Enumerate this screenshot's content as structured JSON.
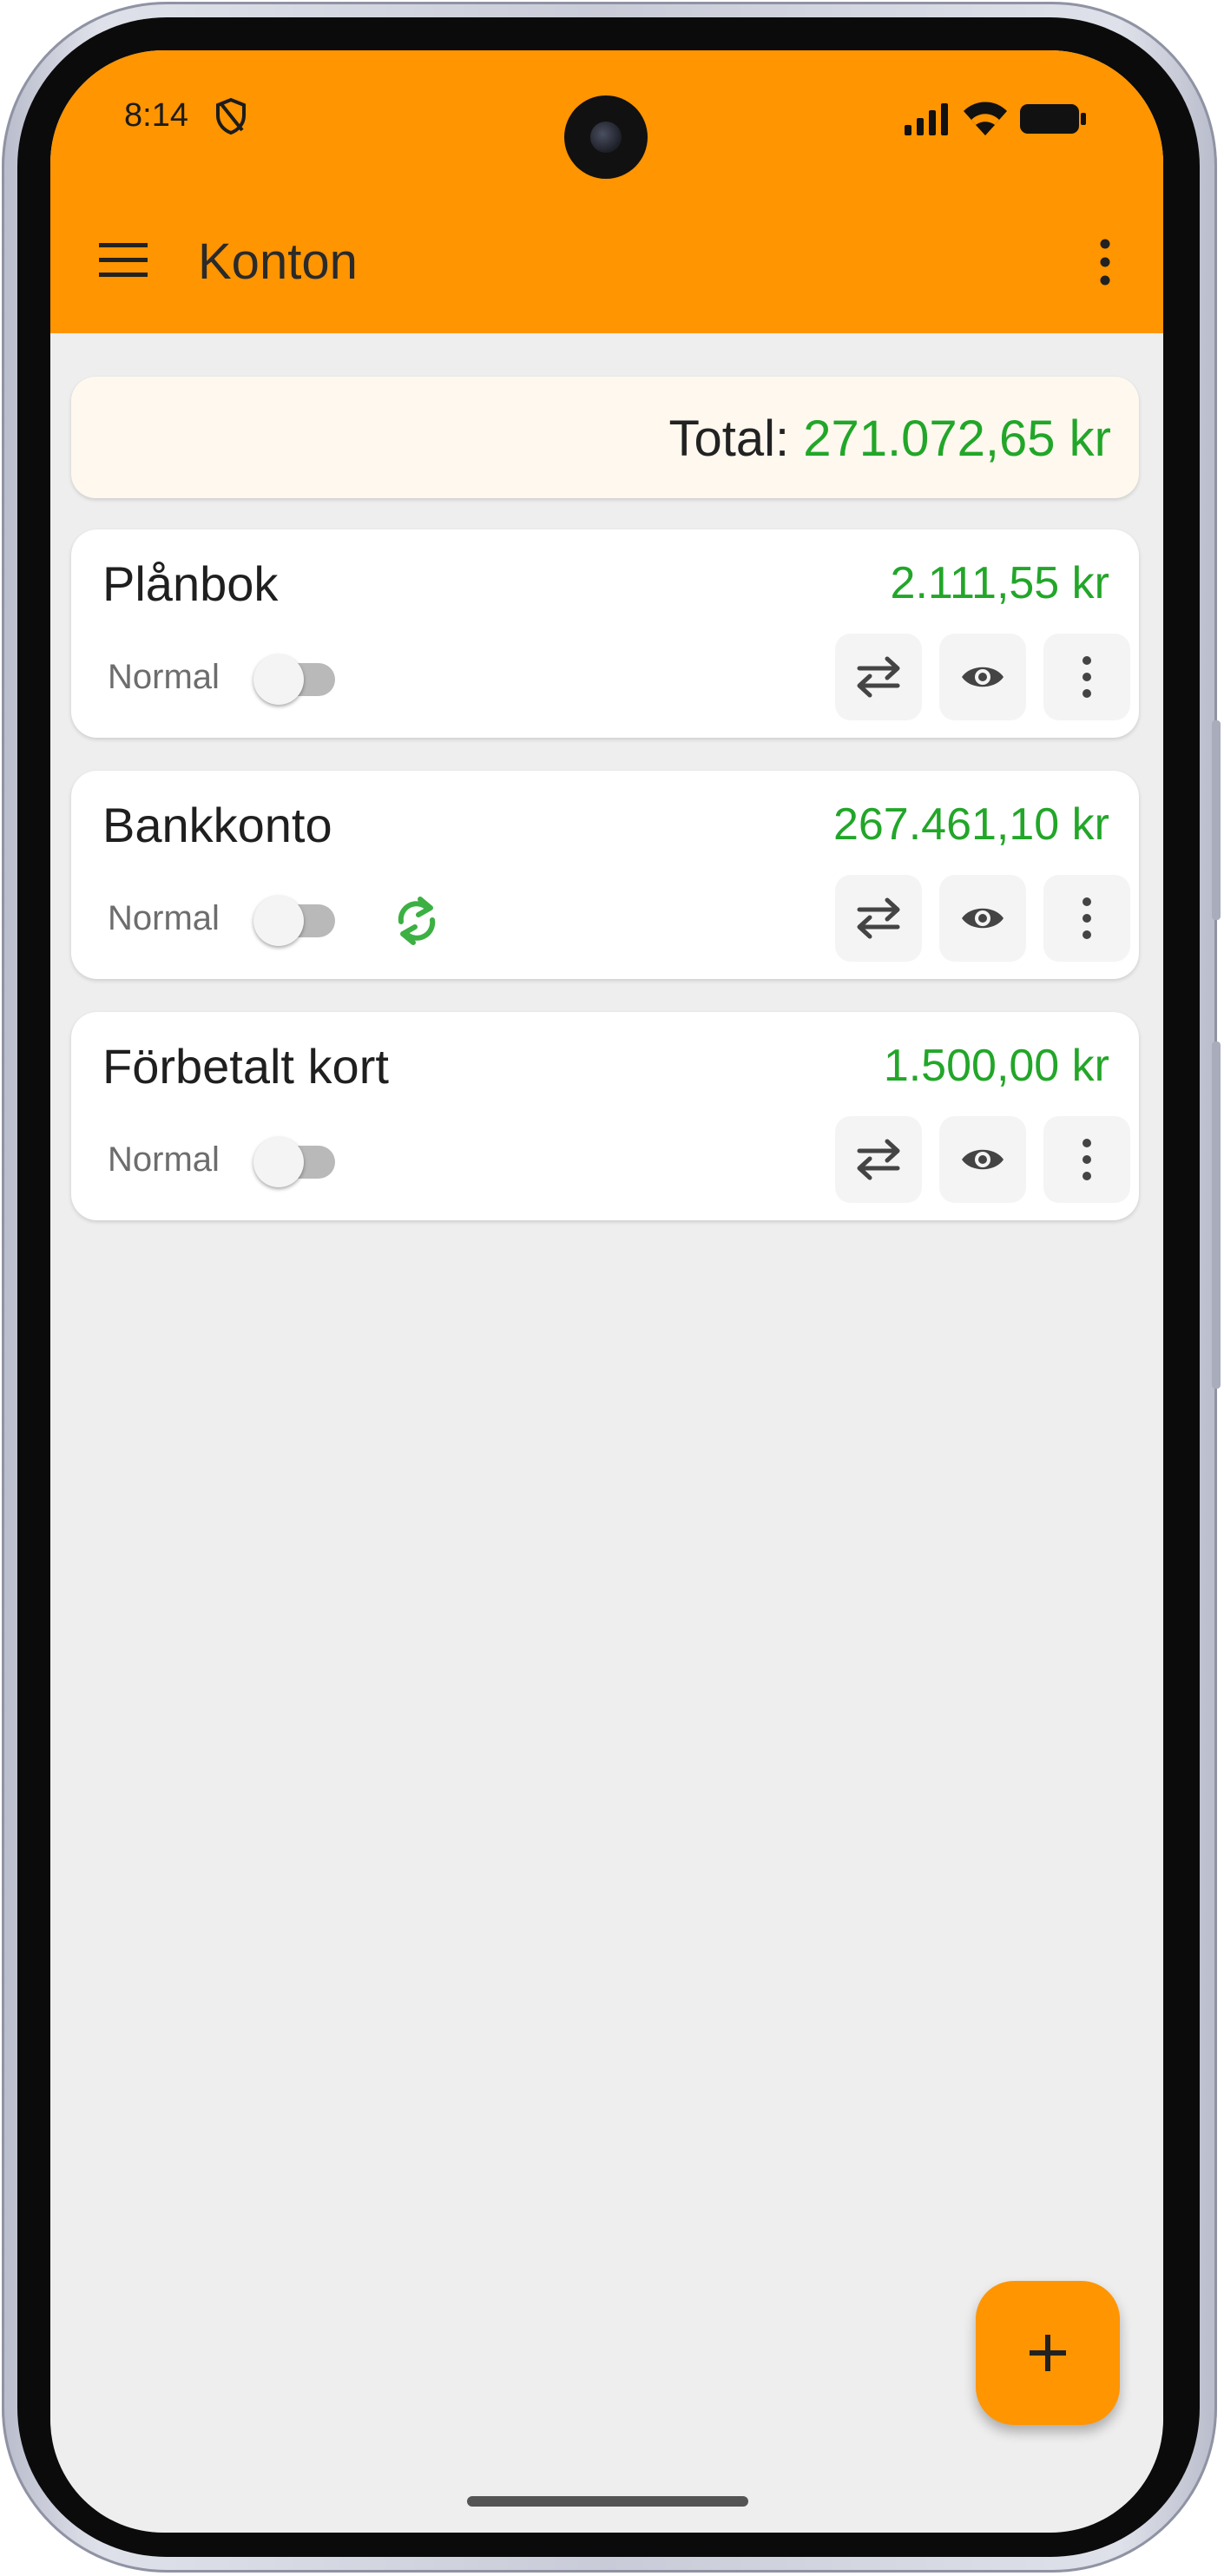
{
  "status_bar": {
    "time": "8:14",
    "icons": [
      "shield-icon",
      "signal-icon",
      "wifi-icon",
      "battery-icon"
    ]
  },
  "app_bar": {
    "title": "Konton",
    "menu_icon": "hamburger-menu-icon",
    "overflow_icon": "more-vert-icon",
    "color": "#ff9500"
  },
  "total": {
    "label": "Total:",
    "amount": "271.072,65 kr"
  },
  "accounts": [
    {
      "name": "Plånbok",
      "balance": "2.111,55 kr",
      "type": "Normal",
      "toggle_on": false,
      "synced": false
    },
    {
      "name": "Bankkonto",
      "balance": "267.461,10 kr",
      "type": "Normal",
      "toggle_on": false,
      "synced": true
    },
    {
      "name": "Förbetalt kort",
      "balance": "1.500,00 kr",
      "type": "Normal",
      "toggle_on": false,
      "synced": false
    }
  ],
  "account_actions": [
    "transfer-icon",
    "eye-icon",
    "more-vert-icon"
  ],
  "fab": {
    "icon": "plus-icon"
  },
  "colors": {
    "accent": "#ff9500",
    "positive": "#22a629",
    "background": "#eeeeee",
    "total_card": "#fef8ee"
  }
}
